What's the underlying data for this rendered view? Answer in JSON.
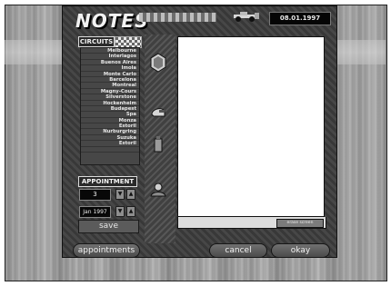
{
  "header": {
    "logo_text": "NOTES",
    "date": "08.01.1997"
  },
  "circuits": {
    "header": "CIRCUITS",
    "items": [
      "Melbourne",
      "Interlagos",
      "Buenos Aires",
      "Imola",
      "Monte Carlo",
      "Barcelona",
      "Montreal",
      "Magny-Cours",
      "Silverstone",
      "Hockenheim",
      "Budapest",
      "Spa",
      "Monza",
      "Estoril",
      "Nurburgring",
      "Suzuka",
      "Estoril"
    ]
  },
  "strip_icons": [
    "helmet-icon",
    "fuel-icon",
    "mechanic-icon",
    "flag-icon"
  ],
  "appointment": {
    "header": "APPOINTMENT",
    "day": "3",
    "month": "Jan 1997",
    "save_label": "save"
  },
  "notes": {
    "text": "",
    "erase_label": "erase screen"
  },
  "footer": {
    "appointments_label": "appointments",
    "cancel_label": "cancel",
    "okay_label": "okay"
  }
}
